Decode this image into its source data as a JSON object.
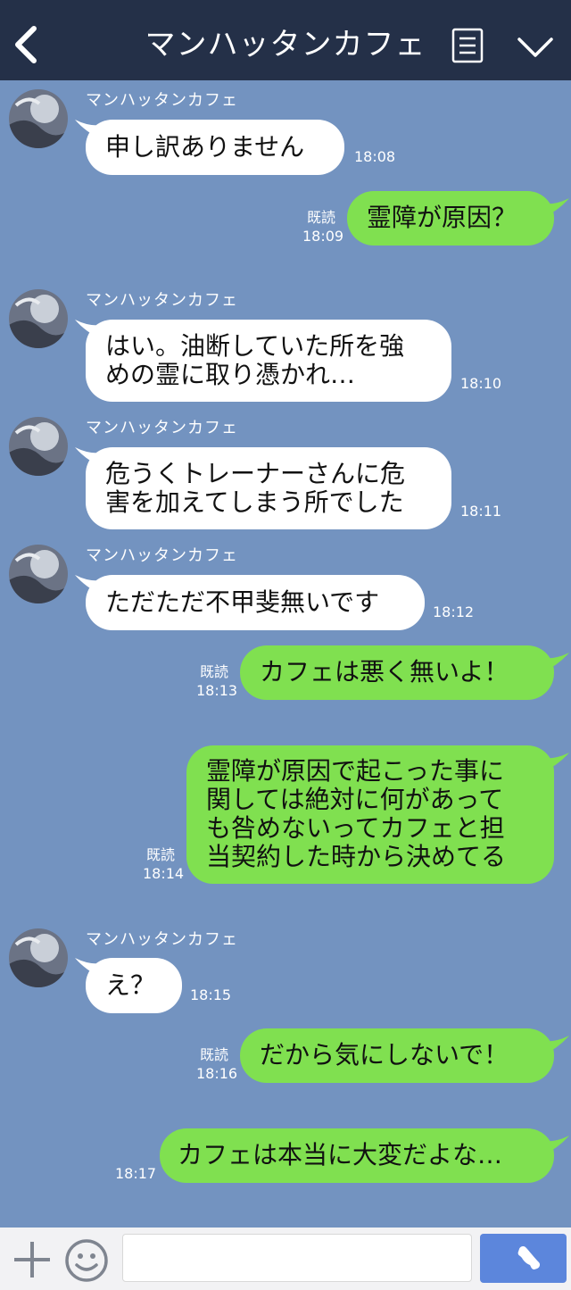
{
  "header": {
    "title": "マンハッタンカフェ",
    "back_icon": "chevron-left-icon",
    "menu_icon": "menu-icon",
    "expand_icon": "chevron-down-icon"
  },
  "messages": [
    {
      "sender": "マンハッタンカフェ",
      "text": "申し訳ありません",
      "time": "18:08"
    },
    {
      "text": "霊障が原因？",
      "read": "既読",
      "time": "18:09"
    },
    {
      "sender": "マンハッタンカフェ",
      "text": "はい。油断していた所を強\nめの霊に取り憑かれ…",
      "time": "18:10"
    },
    {
      "sender": "マンハッタンカフェ",
      "text": "危うくトレーナーさんに危\n害を加えてしまう所でした",
      "time": "18:11"
    },
    {
      "sender": "マンハッタンカフェ",
      "text": "ただただ不甲斐無いです",
      "time": "18:12"
    },
    {
      "text": "カフェは悪く無いよ！",
      "read": "既読",
      "time": "18:13"
    },
    {
      "text": "霊障が原因で起こった事に\n関しては絶対に何があって\nも咎めないってカフェと担\n当契約した時から決めてる",
      "read": "既読",
      "time": "18:14"
    },
    {
      "sender": "マンハッタンカフェ",
      "text": "え？",
      "time": "18:15"
    },
    {
      "text": "だから気にしないで！",
      "read": "既読",
      "time": "18:16"
    },
    {
      "text": "カフェは本当に大変だよな…",
      "time": "18:17"
    }
  ],
  "footer": {
    "plus_icon": "plus-icon",
    "emoji_icon": "smiley-icon",
    "input_value": "",
    "call_icon": "phone-icon"
  },
  "colors": {
    "header": "#243048",
    "background": "#7393c0",
    "incoming": "#ffffff",
    "outgoing": "#80e050",
    "call_button": "#5c86dc"
  }
}
